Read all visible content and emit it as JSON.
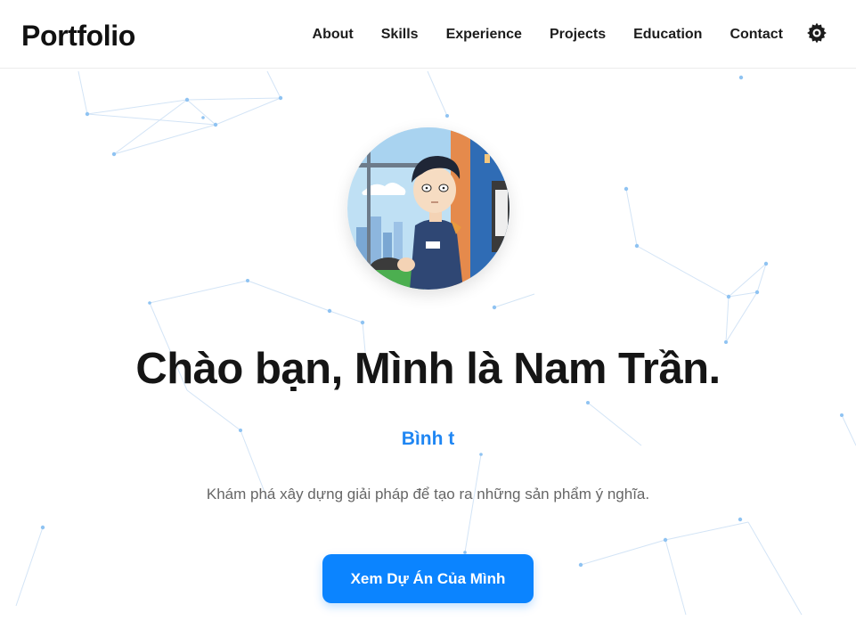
{
  "header": {
    "brand": "Portfolio",
    "nav": [
      "About",
      "Skills",
      "Experience",
      "Projects",
      "Education",
      "Contact"
    ],
    "theme_icon": "gear-icon"
  },
  "hero": {
    "avatar_icon": "avatar-illustration",
    "title": "Chào bạn, Mình là Nam Trần.",
    "role": "Bình t",
    "tagline": "Khám phá xây dựng giải pháp để tạo ra những sản phẩm ý nghĩa.",
    "cta_label": "Xem Dự Án Của Mình"
  },
  "colors": {
    "accent": "#0b84ff",
    "role_text": "#1f86f3",
    "network_lines": "#cfe1f5",
    "network_nodes": "#8ec2f3"
  }
}
